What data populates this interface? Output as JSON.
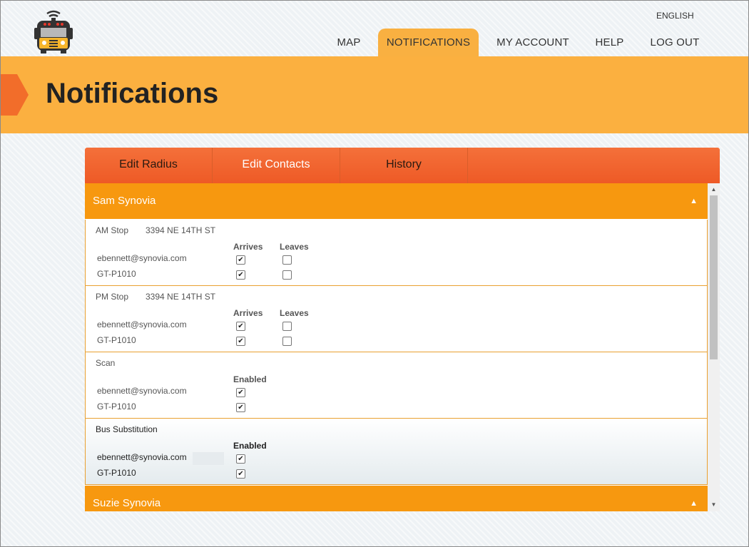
{
  "header": {
    "language": "ENGLISH",
    "nav": [
      {
        "label": "MAP",
        "active": false
      },
      {
        "label": "NOTIFICATIONS",
        "active": true
      },
      {
        "label": "MY ACCOUNT",
        "active": false
      },
      {
        "label": "HELP",
        "active": false
      },
      {
        "label": "LOG OUT",
        "active": false
      }
    ]
  },
  "page": {
    "title": "Notifications"
  },
  "tabs": [
    {
      "label": "Edit Radius",
      "active": false
    },
    {
      "label": "Edit Contacts",
      "active": true
    },
    {
      "label": "History",
      "active": false
    }
  ],
  "students": [
    {
      "name": "Sam Synovia",
      "expanded": true,
      "sections": [
        {
          "label": "AM Stop",
          "address": "3394 NE 14TH ST",
          "columns": [
            "Arrives",
            "Leaves"
          ],
          "contacts": [
            {
              "name": "ebennett@synovia.com",
              "checks": [
                true,
                false
              ]
            },
            {
              "name": "GT-P1010",
              "checks": [
                true,
                false
              ]
            }
          ]
        },
        {
          "label": "PM Stop",
          "address": "3394 NE 14TH ST",
          "columns": [
            "Arrives",
            "Leaves"
          ],
          "contacts": [
            {
              "name": "ebennett@synovia.com",
              "checks": [
                true,
                false
              ]
            },
            {
              "name": "GT-P1010",
              "checks": [
                true,
                false
              ]
            }
          ]
        },
        {
          "label": "Scan",
          "address": "",
          "columns": [
            "Enabled"
          ],
          "contacts": [
            {
              "name": "ebennett@synovia.com",
              "checks": [
                true
              ]
            },
            {
              "name": "GT-P1010",
              "checks": [
                true
              ]
            }
          ]
        },
        {
          "label": "Bus Substitution",
          "address": "",
          "columns": [
            "Enabled"
          ],
          "contacts": [
            {
              "name": "ebennett@synovia.com",
              "checks": [
                true
              ]
            },
            {
              "name": "GT-P1010",
              "checks": [
                true
              ]
            }
          ]
        }
      ]
    },
    {
      "name": "Suzie Synovia",
      "expanded": true
    }
  ],
  "icons": {
    "logo": "school-bus-logo",
    "collapse": "chevron-up-icon",
    "checked": "✔"
  },
  "colors": {
    "banner": "#fbb040",
    "tab_bar": "#f0622c",
    "student_header": "#f7980f",
    "accent_arrow": "#f26d2a"
  }
}
